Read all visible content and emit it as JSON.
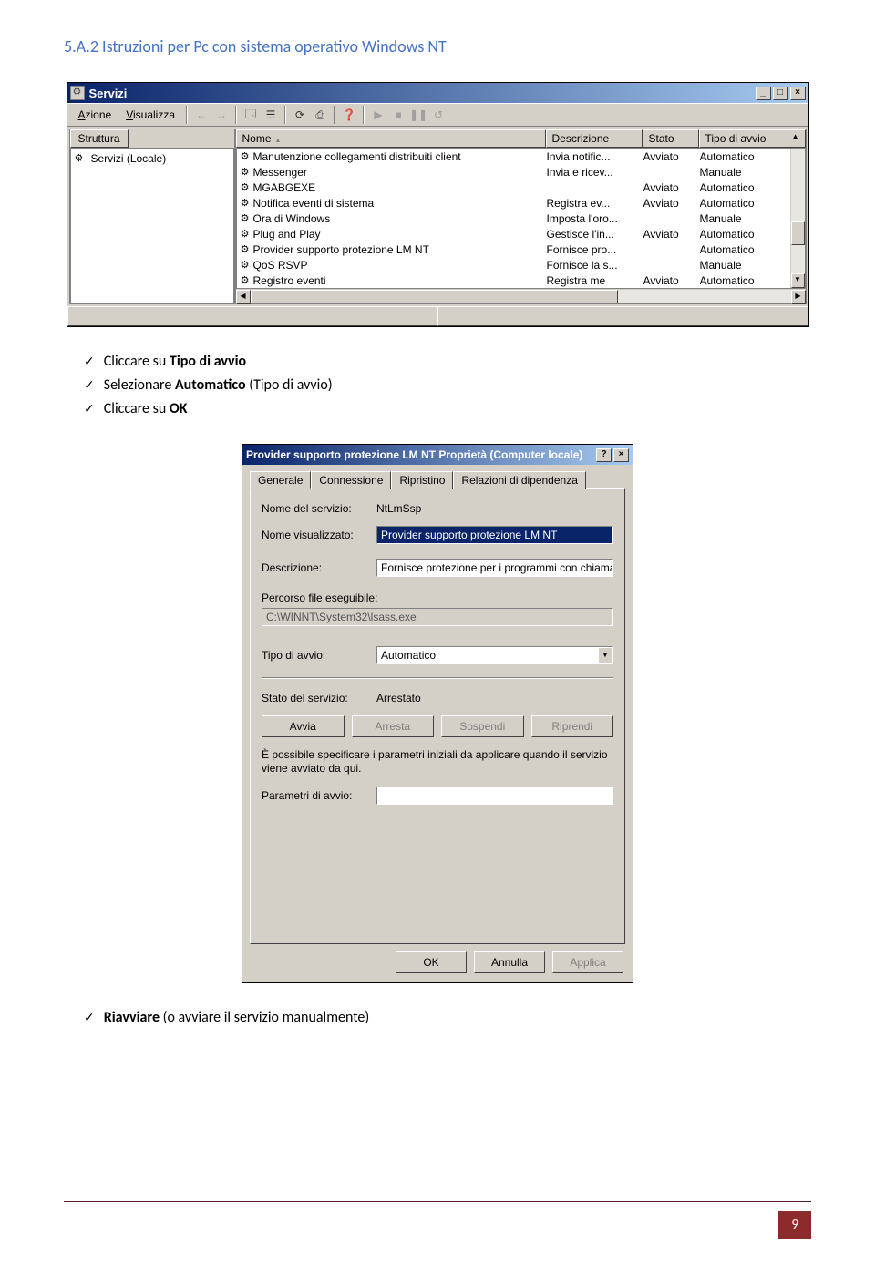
{
  "heading": "5.A.2 Istruzioni per Pc con sistema operativo Windows NT",
  "services": {
    "title": "Servizi",
    "menu": {
      "action": "Azione",
      "view": "Visualizza"
    },
    "tree_tab": "Struttura",
    "tree_item": "Servizi (Locale)",
    "columns": {
      "name": "Nome",
      "desc": "Descrizione",
      "state": "Stato",
      "startup": "Tipo di avvio"
    },
    "rows": [
      {
        "name": "Manutenzione collegamenti distribuiti client",
        "desc": "Invia notific...",
        "state": "Avviato",
        "startup": "Automatico"
      },
      {
        "name": "Messenger",
        "desc": "Invia e ricev...",
        "state": "",
        "startup": "Manuale"
      },
      {
        "name": "MGABGEXE",
        "desc": "",
        "state": "Avviato",
        "startup": "Automatico"
      },
      {
        "name": "Notifica eventi di sistema",
        "desc": "Registra ev...",
        "state": "Avviato",
        "startup": "Automatico"
      },
      {
        "name": "Ora di Windows",
        "desc": "Imposta l'oro...",
        "state": "",
        "startup": "Manuale"
      },
      {
        "name": "Plug and Play",
        "desc": "Gestisce l'in...",
        "state": "Avviato",
        "startup": "Automatico"
      },
      {
        "name": "Provider supporto protezione LM NT",
        "desc": "Fornisce pro...",
        "state": "",
        "startup": "Automatico"
      },
      {
        "name": "QoS RSVP",
        "desc": "Fornisce la s...",
        "state": "",
        "startup": "Manuale"
      },
      {
        "name": "Registro eventi",
        "desc": "Registra me",
        "state": "Avviato",
        "startup": "Automatico"
      }
    ]
  },
  "bullets1": {
    "b1_pre": "Cliccare su",
    "b1_bold": " Tipo di avvio",
    "b2_pre": "Selezionare",
    "b2_bold": " Automatico",
    "b2_post": " (Tipo di avvio)",
    "b3_pre": "Cliccare su",
    "b3_bold": " OK"
  },
  "dialog": {
    "title": "Provider supporto protezione LM NT Proprietà (Computer locale)",
    "tabs": {
      "general": "Generale",
      "conn": "Connessione",
      "recover": "Ripristino",
      "deps": "Relazioni di dipendenza"
    },
    "labels": {
      "svcname": "Nome del servizio:",
      "dispname": "Nome visualizzato:",
      "desc": "Descrizione:",
      "exepath_label": "Percorso file eseguibile:",
      "startup": "Tipo di avvio:",
      "svcstate": "Stato del servizio:",
      "paramhelp": "È possibile specificare i parametri iniziali da applicare quando il servizio viene avviato da qui.",
      "params": "Parametri di avvio:"
    },
    "values": {
      "svcname": "NtLmSsp",
      "dispname": "Provider supporto protezione LM NT",
      "desc": "Fornisce protezione per i programmi con chiamate a pr",
      "exepath": "C:\\WINNT\\System32\\lsass.exe",
      "startup": "Automatico",
      "svcstate": "Arrestato",
      "params": ""
    },
    "buttons": {
      "start": "Avvia",
      "stop": "Arresta",
      "pause": "Sospendi",
      "resume": "Riprendi",
      "ok": "OK",
      "cancel": "Annulla",
      "apply": "Applica"
    }
  },
  "bullets2": {
    "b1_bold": "Riavviare",
    "b1_post": " (o avviare il servizio manualmente)"
  },
  "page_number": "9"
}
